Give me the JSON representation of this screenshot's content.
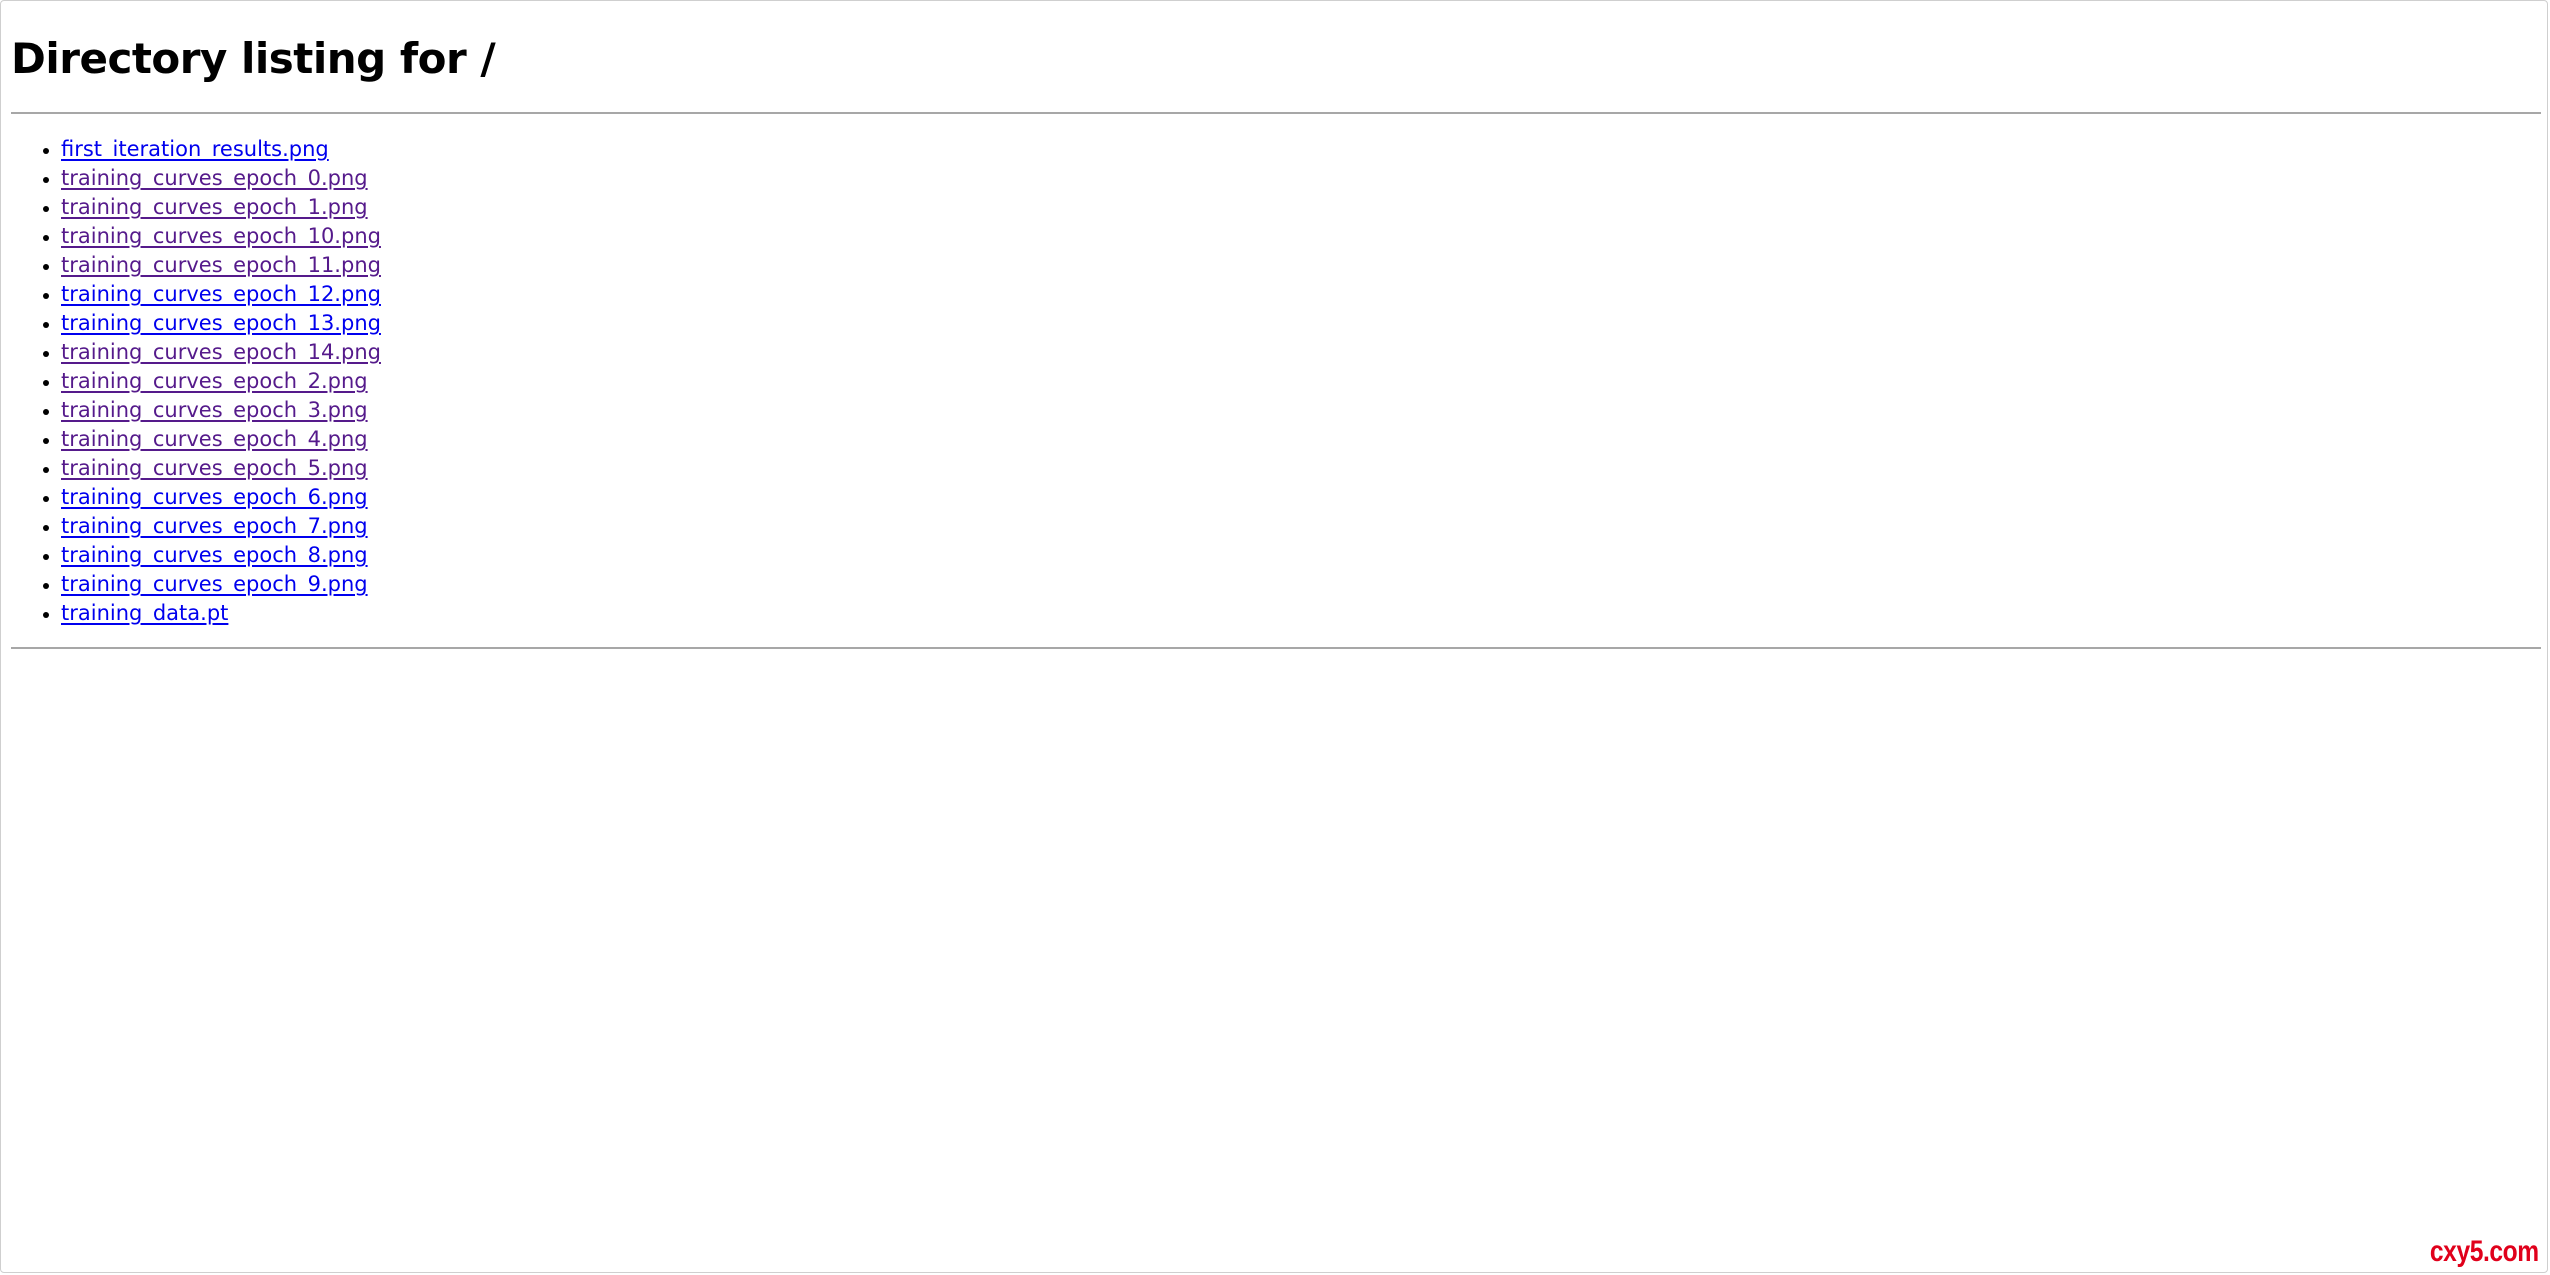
{
  "page": {
    "title": "Directory listing for /"
  },
  "files": [
    {
      "name": "first_iteration_results.png",
      "visited": false
    },
    {
      "name": "training_curves_epoch_0.png",
      "visited": true
    },
    {
      "name": "training_curves_epoch_1.png",
      "visited": true
    },
    {
      "name": "training_curves_epoch_10.png",
      "visited": true
    },
    {
      "name": "training_curves_epoch_11.png",
      "visited": true
    },
    {
      "name": "training_curves_epoch_12.png",
      "visited": false
    },
    {
      "name": "training_curves_epoch_13.png",
      "visited": false
    },
    {
      "name": "training_curves_epoch_14.png",
      "visited": true
    },
    {
      "name": "training_curves_epoch_2.png",
      "visited": true
    },
    {
      "name": "training_curves_epoch_3.png",
      "visited": true
    },
    {
      "name": "training_curves_epoch_4.png",
      "visited": true
    },
    {
      "name": "training_curves_epoch_5.png",
      "visited": true
    },
    {
      "name": "training_curves_epoch_6.png",
      "visited": false
    },
    {
      "name": "training_curves_epoch_7.png",
      "visited": false
    },
    {
      "name": "training_curves_epoch_8.png",
      "visited": false
    },
    {
      "name": "training_curves_epoch_9.png",
      "visited": false
    },
    {
      "name": "training_data.pt",
      "visited": false
    }
  ],
  "watermark": {
    "text": "cxy5.com"
  },
  "colors": {
    "link": "#0000ee",
    "link_visited": "#551a8b",
    "watermark": "#e0001b",
    "rule": "#a7a7a7"
  }
}
